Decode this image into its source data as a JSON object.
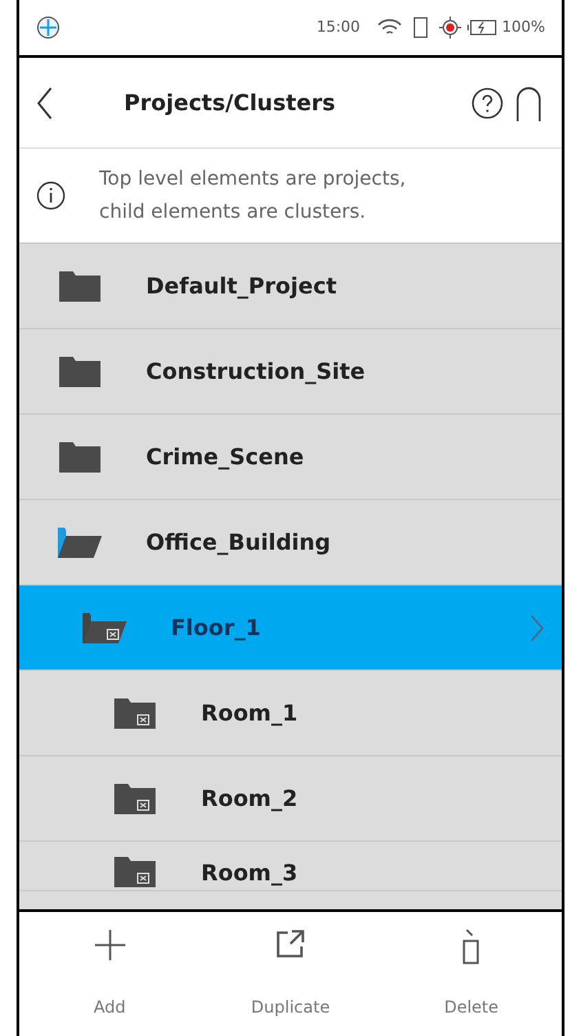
{
  "status_bar": {
    "time": "15:00",
    "battery": "100%"
  },
  "header": {
    "title": "Projects/Clusters"
  },
  "info": {
    "text": "Top level elements are projects, child elements are clusters."
  },
  "tree": [
    {
      "label": "Default_Project",
      "kind": "project",
      "selected": false,
      "expanded": false
    },
    {
      "label": "Construction_Site",
      "kind": "project",
      "selected": false,
      "expanded": false
    },
    {
      "label": "Crime_Scene",
      "kind": "project",
      "selected": false,
      "expanded": false
    },
    {
      "label": "Office_Building",
      "kind": "project",
      "selected": false,
      "expanded": true,
      "children": [
        {
          "label": "Floor_1",
          "kind": "cluster",
          "selected": true,
          "expanded": true,
          "children": [
            {
              "label": "Room_1",
              "kind": "cluster",
              "selected": false,
              "expanded": false
            },
            {
              "label": "Room_2",
              "kind": "cluster",
              "selected": false,
              "expanded": false
            },
            {
              "label": "Room_3",
              "kind": "cluster",
              "selected": false,
              "expanded": false
            }
          ]
        }
      ]
    }
  ],
  "toolbar": [
    {
      "label": "Add",
      "kind": "add"
    },
    {
      "label": "Duplicate",
      "kind": "duplicate"
    },
    {
      "label": "Delete",
      "kind": "delete"
    }
  ]
}
